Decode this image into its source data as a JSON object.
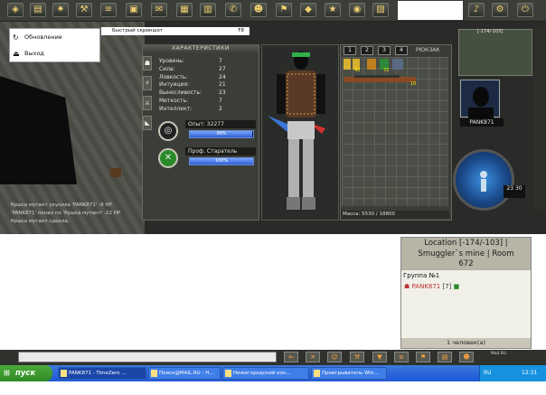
{
  "context_menu": {
    "items": [
      {
        "label": "Обновление"
      },
      {
        "label": "Выход"
      }
    ],
    "screenshot_hint": "Быстрый скриншот",
    "screenshot_shortcut": "F8"
  },
  "characteristics": {
    "title": "ХАРАКТЕРИСТИКИ",
    "stats": [
      {
        "label": "Уровень:",
        "value": "7"
      },
      {
        "label": "Сила:",
        "value": "27"
      },
      {
        "label": "Ловкость:",
        "value": "24"
      },
      {
        "label": "Интуиция:",
        "value": "21"
      },
      {
        "label": "Выносливость:",
        "value": "23"
      },
      {
        "label": "Меткость:",
        "value": "7"
      },
      {
        "label": "Интеллект:",
        "value": "2"
      }
    ],
    "experience": {
      "label": "Опыт: 32277",
      "percent_text": "99%",
      "fill": 0.99
    },
    "profession": {
      "label": "Проф. Старатель",
      "percent_text": "100%",
      "fill": 1.0
    }
  },
  "backpack": {
    "title": "РЮКЗАК",
    "tabs": [
      "1",
      "2",
      "3",
      "4"
    ],
    "mass": "Масса: 5530 / 18800",
    "item_qty": [
      "40",
      "72",
      "10"
    ]
  },
  "hud": {
    "map_title": "[-174/-103]",
    "player_name": "PANK871",
    "time": "23\n30"
  },
  "chat": [
    {
      "text": "Крыса мутант укусила 'PANK871' -8 HP"
    },
    {
      "text": "'PANK871' попал по 'Крыса мутант' -22 HP"
    },
    {
      "text": "Крыса мутант сдохла."
    }
  ],
  "location": {
    "line1": "Location [-174/-103] |",
    "line2": "Smuggler`s mine | Room",
    "line3": "672",
    "group_title": "Группа №1",
    "member_name": "PANK871",
    "member_rank": "[7]",
    "count": "1 человек(а)"
  },
  "mailru": "Mail.RU",
  "taskbar": {
    "start_label": "пуск",
    "items": [
      {
        "label": "PANK871 - TimeZero ..."
      },
      {
        "label": "Поиск@MAIL.RU - Н..."
      },
      {
        "label": "Нижегородский кон..."
      },
      {
        "label": "Проигрыватель Win..."
      }
    ],
    "lang": "RU",
    "clock": "12:31"
  },
  "colors": {
    "accent": "#245edb",
    "start_green": "#2f8a24",
    "hp_red": "#ff6666"
  }
}
